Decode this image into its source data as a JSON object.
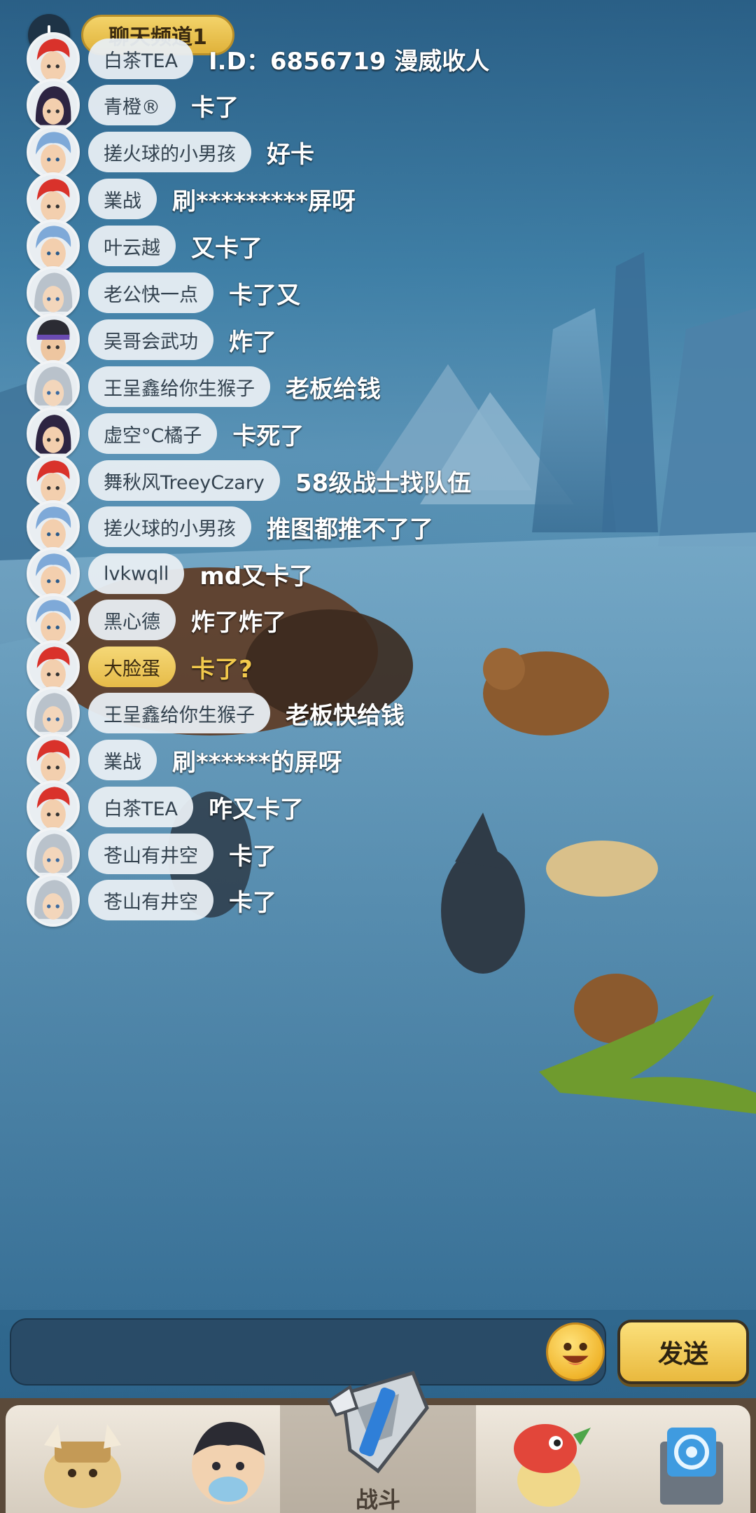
{
  "top": {
    "channel_label": "聊天频道1"
  },
  "messages": [
    {
      "name": "白茶TEA",
      "text": "I.D：6856719 漫威收人",
      "avatar": "red-hair-boy",
      "gold": false
    },
    {
      "name": "青橙®",
      "text": "卡了",
      "avatar": "purple-hair-girl",
      "gold": false
    },
    {
      "name": "搓火球的小男孩",
      "text": "好卡",
      "avatar": "blue-hair-boy",
      "gold": false
    },
    {
      "name": "業战",
      "text": "刷*********屏呀",
      "avatar": "red-hair-boy",
      "gold": false
    },
    {
      "name": "叶云越",
      "text": "又卡了",
      "avatar": "blue-hair-boy",
      "gold": false
    },
    {
      "name": "老公快一点",
      "text": "卡了又",
      "avatar": "silver-hair-girl",
      "gold": false
    },
    {
      "name": "吴哥会武功",
      "text": "炸了",
      "avatar": "headband-boy",
      "gold": false
    },
    {
      "name": "王呈鑫给你生猴子",
      "text": "老板给钱",
      "avatar": "silver-hair-girl",
      "gold": false
    },
    {
      "name": "虚空°C橘子",
      "text": "卡死了",
      "avatar": "purple-hair-girl",
      "gold": false
    },
    {
      "name": "舞秋风TreeyCzary",
      "text": "58级战士找队伍",
      "avatar": "red-hair-boy",
      "gold": false
    },
    {
      "name": "搓火球的小男孩",
      "text": "推图都推不了了",
      "avatar": "blue-hair-boy",
      "gold": false
    },
    {
      "name": "lvkwqll",
      "text": "md又卡了",
      "avatar": "blue-hair-boy",
      "gold": false
    },
    {
      "name": "黑心德",
      "text": "炸了炸了",
      "avatar": "blue-hair-boy",
      "gold": false
    },
    {
      "name": "大脸蛋",
      "text": "卡了?",
      "avatar": "red-hair-boy",
      "gold": true
    },
    {
      "name": "王呈鑫给你生猴子",
      "text": "老板快给钱",
      "avatar": "silver-hair-girl",
      "gold": false
    },
    {
      "name": "業战",
      "text": "刷******的屏呀",
      "avatar": "red-hair-boy",
      "gold": false
    },
    {
      "name": "白茶TEA",
      "text": "咋又卡了",
      "avatar": "red-hair-boy",
      "gold": false
    },
    {
      "name": "苍山有井空",
      "text": "卡了",
      "avatar": "silver-hair-girl",
      "gold": false
    },
    {
      "name": "苍山有井空",
      "text": "卡了",
      "avatar": "silver-hair-girl",
      "gold": false
    }
  ],
  "input": {
    "send_label": "发送"
  },
  "nav": {
    "tabs": [
      {
        "icon": "tribe-warrior-icon"
      },
      {
        "icon": "hero-face-icon"
      },
      {
        "icon": "battle-sword-icon",
        "label": "战斗",
        "active": true
      },
      {
        "icon": "pet-dragon-icon"
      },
      {
        "icon": "portal-icon"
      }
    ]
  },
  "colors": {
    "accent_gold": "#f2c94c",
    "pill": "#e8eef3",
    "nav_bg": "#efe8dd"
  }
}
